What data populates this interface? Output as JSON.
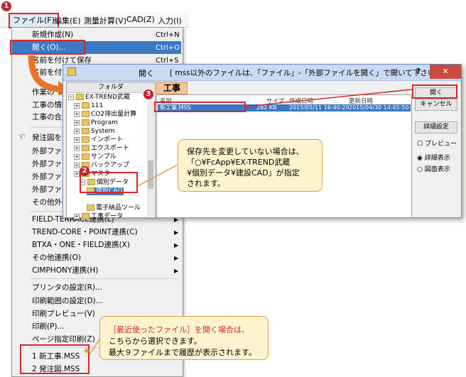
{
  "steps": {
    "one": "1",
    "two": "2",
    "three": "3"
  },
  "menubar": {
    "file": "ファイル(F)",
    "edit": "編集(E)",
    "survey": "測量計算(V)",
    "cad": "CAD(Z)",
    "input": "入力(I)"
  },
  "menu": {
    "new": "新規作成(N)",
    "new_sc": "Ctrl+N",
    "open": "開く(O)...",
    "open_sc": "Ctrl+O",
    "save_as": "名前を付けて保存",
    "save_as_sc": "Ctrl+S",
    "name_attach": "名前を付け",
    "work_info": "作業の",
    "work_info2": "工事の情報",
    "work_combine": "工事の合成",
    "order_doc": "発注図を開",
    "ext_file1": "外部ファイル",
    "ext_file2": "外部ファイル",
    "ext_file3": "外部ファイル",
    "ext_file4": "外部ファイル",
    "other_ext": "その他外部",
    "field_terrace": "FIELD-TERRACE連携(L)",
    "trend_core": "TREND-CORE・POINT連携(C)",
    "btxa": "BTXA・ONE・FIELD連携(X)",
    "other_link": "その他連携(O)",
    "cimphony": "CIMPHONY連携(H)",
    "printer": "プリンタの設定(R)...",
    "print_range": "印刷範囲の設定(D)...",
    "print_preview": "印刷プレビュー(V)",
    "print": "印刷(P)...",
    "page_print": "ページ指定印刷(Z)",
    "recent1": "1 新工事.MSS",
    "recent2": "2 発注図.MSS"
  },
  "dialog": {
    "title": "開く",
    "message": "[ mss以外のファイルは、「ファイル」-「外部ファイルを開く」で開いて下さい。]",
    "help": "?",
    "close": "✕",
    "folder_header": "フォルダ",
    "tree": [
      "EX-TREND武蔵",
      "111",
      "CO2排出量計算",
      "Program",
      "System",
      "インポート",
      "エクスポート",
      "サンプル",
      "バックアップ",
      "マスター",
      "個別データ",
      "建設CAD",
      "電子納品ツール",
      "工事データ"
    ],
    "work_tab": "工事",
    "columns": {
      "name": "名前",
      "size": "サイズ",
      "created": "作成日時",
      "updated": "更新日時"
    },
    "file": {
      "name": "新工事.MSS",
      "size": "262 KB",
      "created": "2015/05/11 16:40:29",
      "updated": "2015/04/30 14:45:50"
    },
    "buttons": {
      "ok": "開く",
      "cancel": "キャンセル",
      "details": "詳細設定"
    },
    "preview": "プレビュー",
    "detail_view": "詳細表示",
    "icon_view": "図面表示"
  },
  "callouts": {
    "save_note": [
      "保存先を変更していない場合は、",
      "「○¥FcApp¥EX-TREND武蔵",
      "¥個別データ¥建設CAD」が指定",
      "されます。"
    ],
    "recent_note": [
      "［最近使ったファイル］を開く場合は、",
      "こちらから選択できます。",
      "最大９ファイルまで履歴が表示されます。"
    ]
  },
  "colors": {
    "accent_red": "#d8262c",
    "highlight_blue": "#3a78c3",
    "callout_bg": "#fdf3cf",
    "tab_orange": "#f6c496"
  }
}
